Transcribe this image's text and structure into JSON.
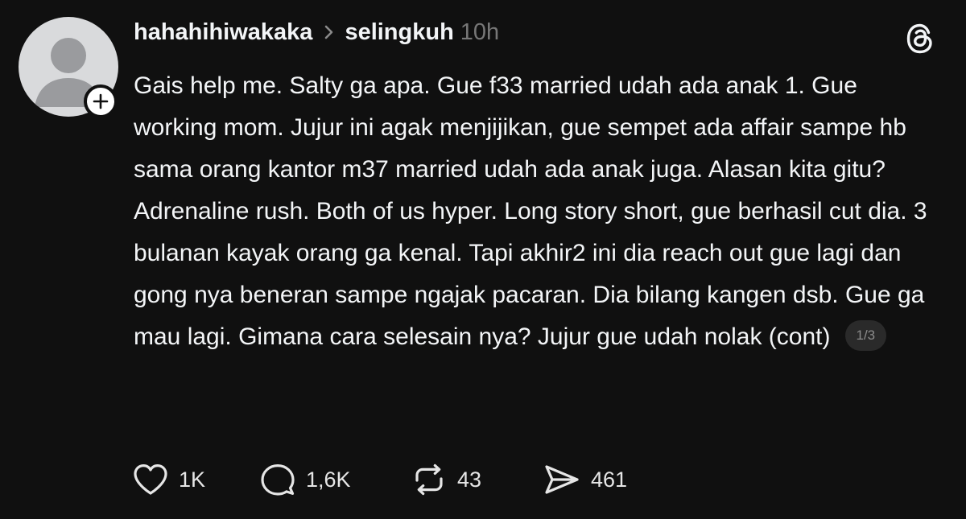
{
  "post": {
    "username": "hahahihiwakaka",
    "topic": "selingkuh",
    "time": "10h",
    "body": "Gais help me. Salty ga apa. Gue f33 married udah ada anak 1. Gue working mom. Jujur ini agak menjijikan, gue sempet ada affair sampe hb sama orang kantor m37 married udah ada anak juga. Alasan kita gitu? Adrenaline rush. Both of us hyper. Long story short, gue berhasil cut dia. 3 bulanan kayak orang ga kenal. Tapi akhir2 ini dia reach out gue lagi dan gong nya beneran sampe ngajak pacaran. Dia bilang kangen dsb. Gue ga mau lagi. Gimana cara selesain nya? Jujur gue udah nolak (cont)",
    "page_indicator": "1/3"
  },
  "actions": {
    "likes": "1K",
    "replies": "1,6K",
    "reposts": "43",
    "shares": "461"
  },
  "icons": {
    "avatar": "default-avatar-icon",
    "follow": "plus-icon",
    "separator": "chevron-right-icon",
    "app": "threads-logo-icon",
    "like": "heart-icon",
    "reply": "comment-bubble-icon",
    "repost": "repost-icon",
    "share": "send-icon"
  },
  "colors": {
    "background": "#101010",
    "text": "#f3f5f7",
    "muted": "#777777",
    "avatar_bg": "#d9dadc",
    "avatar_fg": "#9a9b9e"
  }
}
